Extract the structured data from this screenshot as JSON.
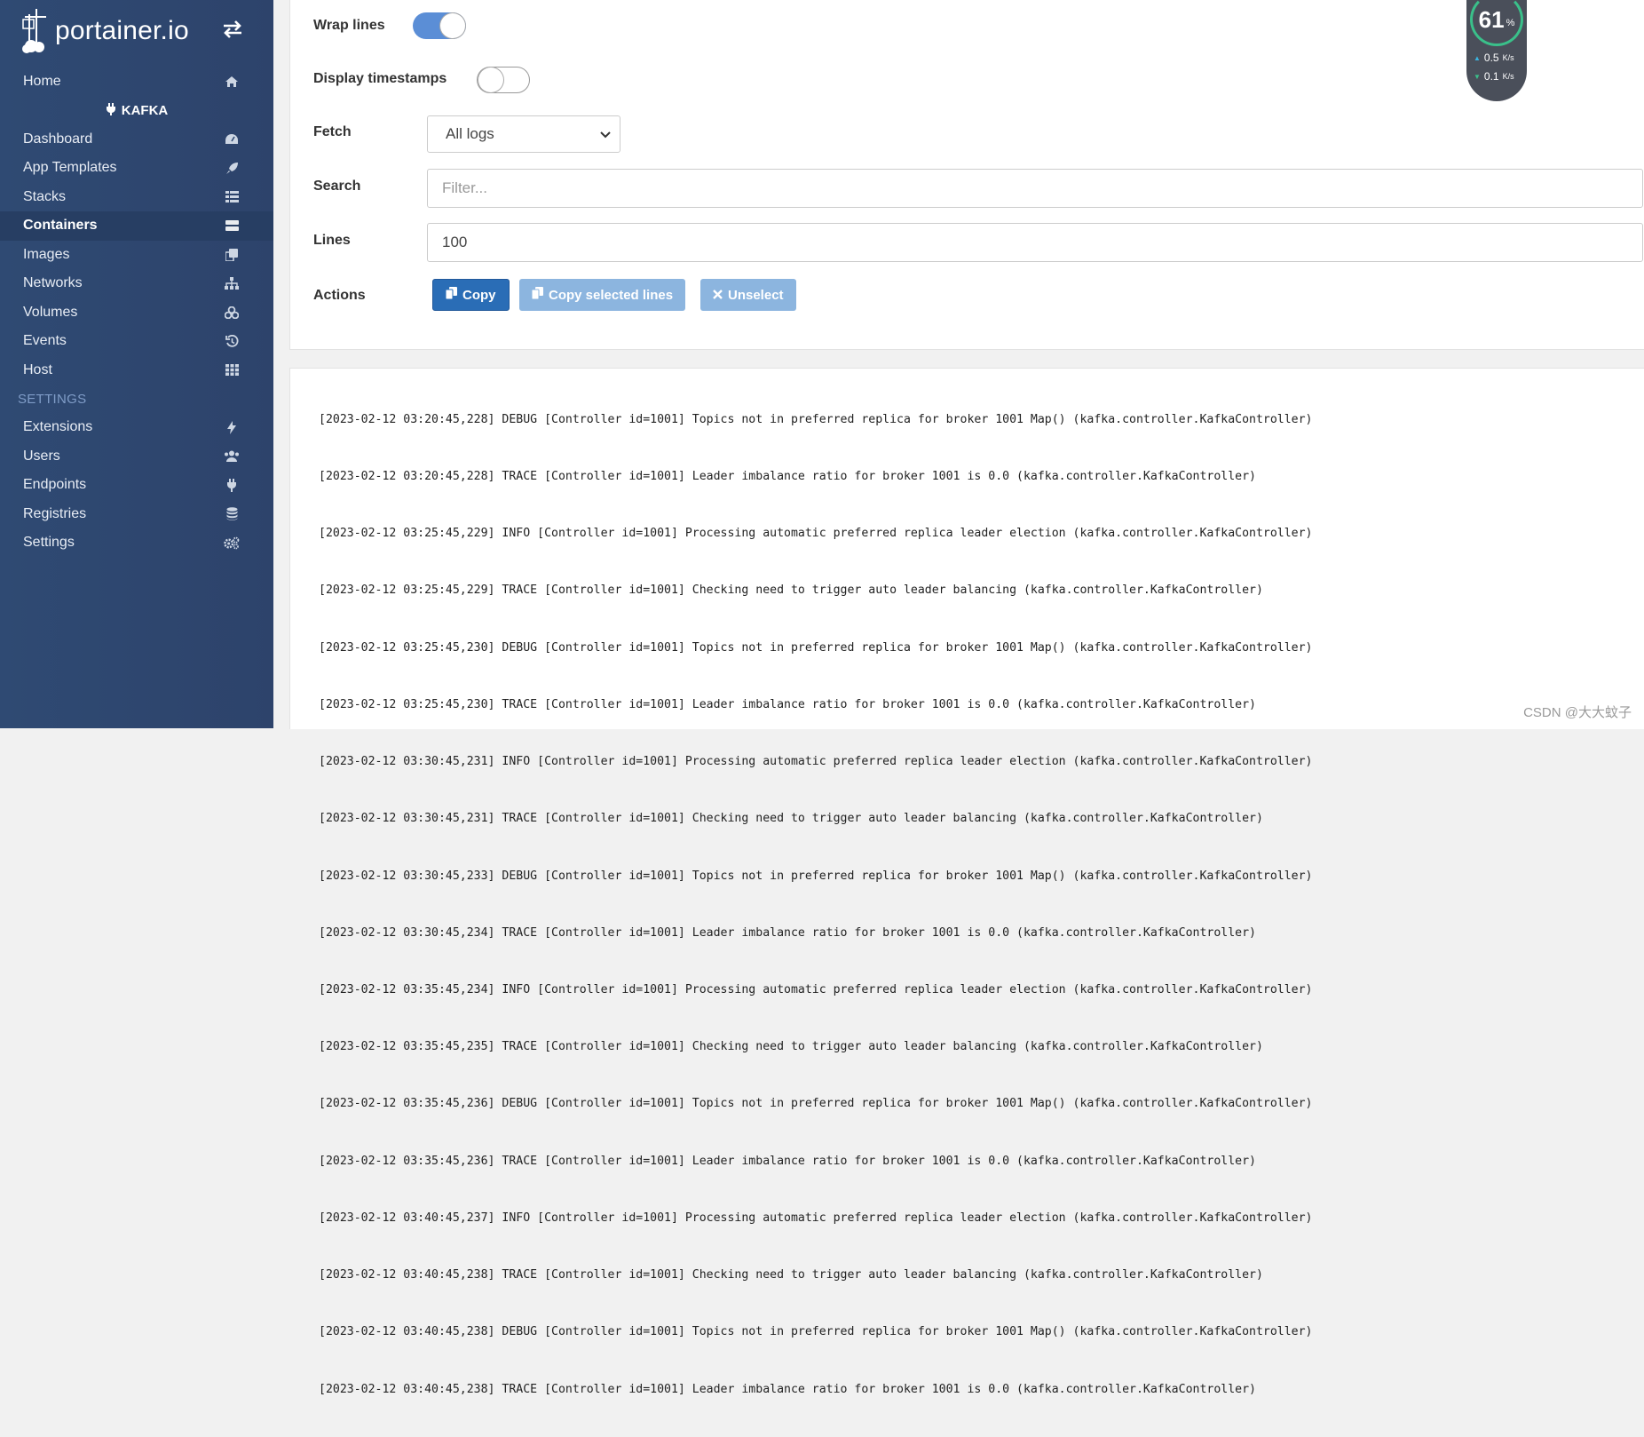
{
  "app": {
    "logo_text": "portainer.io"
  },
  "sidebar": {
    "items_top": [
      {
        "label": "Home",
        "icon": "home-icon"
      }
    ],
    "environment": {
      "label": "KAFKA",
      "icon": "plug-icon"
    },
    "items_env": [
      {
        "label": "Dashboard",
        "icon": "dashboard-icon"
      },
      {
        "label": "App Templates",
        "icon": "rocket-icon"
      },
      {
        "label": "Stacks",
        "icon": "list-icon"
      },
      {
        "label": "Containers",
        "icon": "server-icon",
        "active": true
      },
      {
        "label": "Images",
        "icon": "clone-icon"
      },
      {
        "label": "Networks",
        "icon": "sitemap-icon"
      },
      {
        "label": "Volumes",
        "icon": "cubes-icon"
      },
      {
        "label": "Events",
        "icon": "history-icon"
      },
      {
        "label": "Host",
        "icon": "grid-icon"
      }
    ],
    "settings_label": "SETTINGS",
    "items_settings": [
      {
        "label": "Extensions",
        "icon": "bolt-icon"
      },
      {
        "label": "Users",
        "icon": "users-icon"
      },
      {
        "label": "Endpoints",
        "icon": "plug-icon"
      },
      {
        "label": "Registries",
        "icon": "database-icon"
      },
      {
        "label": "Settings",
        "icon": "cogs-icon"
      }
    ]
  },
  "log_settings": {
    "wrap_lines": {
      "label": "Wrap lines",
      "on": true
    },
    "display_timestamps": {
      "label": "Display timestamps",
      "on": false
    },
    "fetch": {
      "label": "Fetch",
      "value": "All logs"
    },
    "search": {
      "label": "Search",
      "placeholder": "Filter..."
    },
    "lines": {
      "label": "Lines",
      "value": "100"
    },
    "actions": {
      "label": "Actions",
      "copy": "Copy",
      "copy_selected": "Copy selected lines",
      "unselect": "Unselect"
    }
  },
  "logs": [
    "[2023-02-12 03:20:45,228] DEBUG [Controller id=1001] Topics not in preferred replica for broker 1001 Map() (kafka.controller.KafkaController)",
    "[2023-02-12 03:20:45,228] TRACE [Controller id=1001] Leader imbalance ratio for broker 1001 is 0.0 (kafka.controller.KafkaController)",
    "[2023-02-12 03:25:45,229] INFO [Controller id=1001] Processing automatic preferred replica leader election (kafka.controller.KafkaController)",
    "[2023-02-12 03:25:45,229] TRACE [Controller id=1001] Checking need to trigger auto leader balancing (kafka.controller.KafkaController)",
    "[2023-02-12 03:25:45,230] DEBUG [Controller id=1001] Topics not in preferred replica for broker 1001 Map() (kafka.controller.KafkaController)",
    "[2023-02-12 03:25:45,230] TRACE [Controller id=1001] Leader imbalance ratio for broker 1001 is 0.0 (kafka.controller.KafkaController)",
    "[2023-02-12 03:30:45,231] INFO [Controller id=1001] Processing automatic preferred replica leader election (kafka.controller.KafkaController)",
    "[2023-02-12 03:30:45,231] TRACE [Controller id=1001] Checking need to trigger auto leader balancing (kafka.controller.KafkaController)",
    "[2023-02-12 03:30:45,233] DEBUG [Controller id=1001] Topics not in preferred replica for broker 1001 Map() (kafka.controller.KafkaController)",
    "[2023-02-12 03:30:45,234] TRACE [Controller id=1001] Leader imbalance ratio for broker 1001 is 0.0 (kafka.controller.KafkaController)",
    "[2023-02-12 03:35:45,234] INFO [Controller id=1001] Processing automatic preferred replica leader election (kafka.controller.KafkaController)",
    "[2023-02-12 03:35:45,235] TRACE [Controller id=1001] Checking need to trigger auto leader balancing (kafka.controller.KafkaController)",
    "[2023-02-12 03:35:45,236] DEBUG [Controller id=1001] Topics not in preferred replica for broker 1001 Map() (kafka.controller.KafkaController)",
    "[2023-02-12 03:35:45,236] TRACE [Controller id=1001] Leader imbalance ratio for broker 1001 is 0.0 (kafka.controller.KafkaController)",
    "[2023-02-12 03:40:45,237] INFO [Controller id=1001] Processing automatic preferred replica leader election (kafka.controller.KafkaController)",
    "[2023-02-12 03:40:45,238] TRACE [Controller id=1001] Checking need to trigger auto leader balancing (kafka.controller.KafkaController)",
    "[2023-02-12 03:40:45,238] DEBUG [Controller id=1001] Topics not in preferred replica for broker 1001 Map() (kafka.controller.KafkaController)",
    "[2023-02-12 03:40:45,238] TRACE [Controller id=1001] Leader imbalance ratio for broker 1001 is 0.0 (kafka.controller.KafkaController)"
  ],
  "widget": {
    "percent": "61",
    "percent_unit": "%",
    "upload": "0.5",
    "download": "0.1",
    "rate_unit": "K/s"
  },
  "watermark": "CSDN @大大蚊子",
  "colors": {
    "sidebar": "#2f4a73",
    "primary": "#2a6db6",
    "primary_light": "#8cb5df",
    "toggle_on": "#5b8ed6"
  }
}
